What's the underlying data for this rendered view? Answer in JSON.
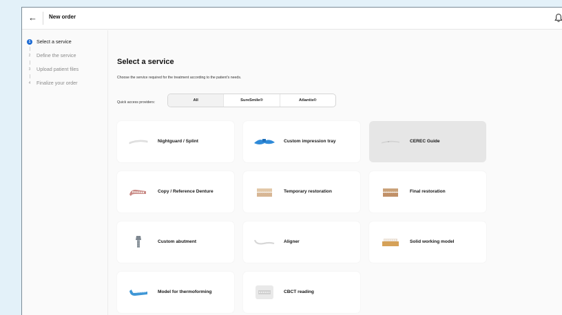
{
  "header": {
    "back_icon": "arrow-left-icon",
    "title": "New order",
    "bell_icon": "bell-icon"
  },
  "steps": [
    {
      "num": "1",
      "label": "Select a service",
      "active": true
    },
    {
      "num": "2",
      "label": "Define the service",
      "active": false
    },
    {
      "num": "3",
      "label": "Upload patient files",
      "active": false
    },
    {
      "num": "4",
      "label": "Finalize your order",
      "active": false
    }
  ],
  "main": {
    "heading": "Select a service",
    "subtitle": "Choose the service required for the treatment according to the patient's needs.",
    "quick_access_label": "Quick access providers:",
    "providers": [
      "All",
      "SureSmile®",
      "Atlantis®"
    ],
    "selected_provider": "All"
  },
  "services": [
    {
      "label": "Nightguard / Splint",
      "icon": "splint-icon",
      "disabled": false
    },
    {
      "label": "Custom impression tray",
      "icon": "impression-tray-icon",
      "disabled": false
    },
    {
      "label": "CEREC Guide",
      "icon": "cerec-guide-icon",
      "disabled": true
    },
    {
      "label": "Copy / Reference Denture",
      "icon": "denture-icon",
      "disabled": false
    },
    {
      "label": "Temporary restoration",
      "icon": "temporary-restoration-icon",
      "disabled": false
    },
    {
      "label": "Final restoration",
      "icon": "final-restoration-icon",
      "disabled": false
    },
    {
      "label": "Custom abutment",
      "icon": "abutment-icon",
      "disabled": false
    },
    {
      "label": "Aligner",
      "icon": "aligner-icon",
      "disabled": false
    },
    {
      "label": "Solid working model",
      "icon": "working-model-icon",
      "disabled": false
    },
    {
      "label": "Model for thermoforming",
      "icon": "thermoforming-model-icon",
      "disabled": false
    },
    {
      "label": "CBCT reading",
      "icon": "cbct-icon",
      "disabled": false
    }
  ],
  "colors": {
    "accent": "#1c6bd4",
    "background": "#e3f1f9",
    "card": "#ffffff",
    "card_disabled": "#e6e6e6"
  }
}
